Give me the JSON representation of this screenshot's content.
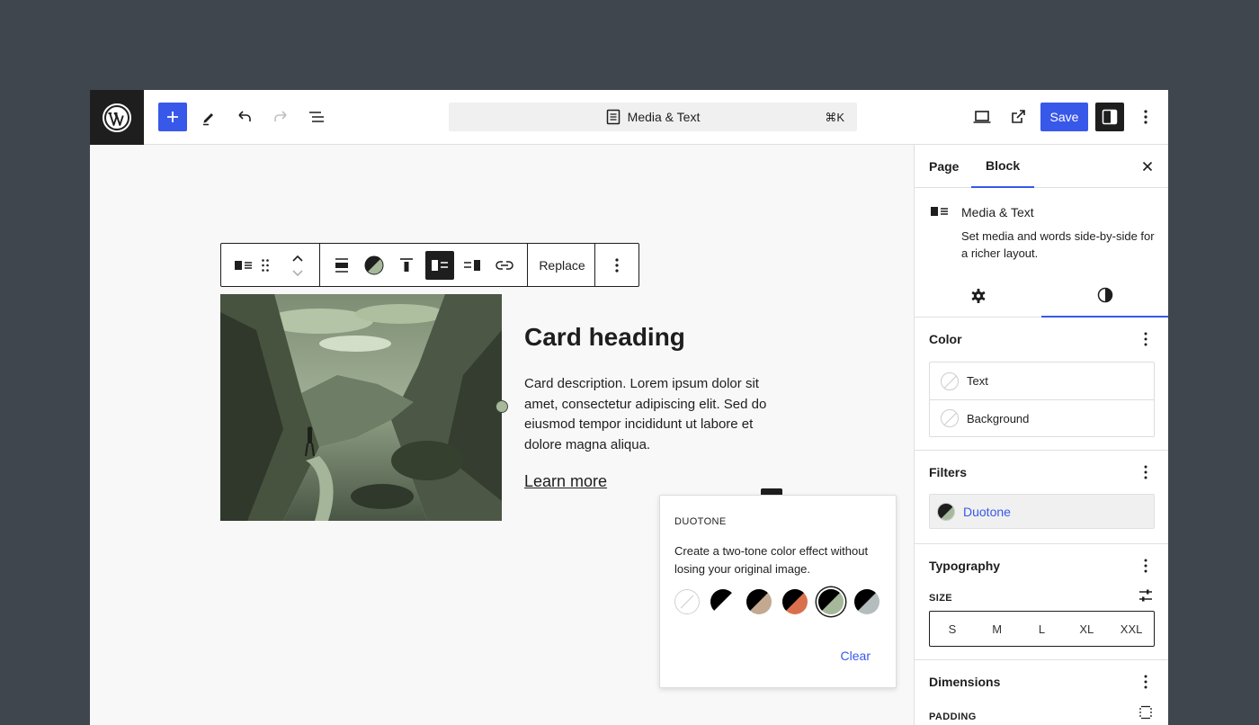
{
  "topbar": {
    "command_title": "Media & Text",
    "command_shortcut": "⌘K",
    "save_label": "Save"
  },
  "block_toolbar": {
    "replace_label": "Replace"
  },
  "content": {
    "heading": "Card heading",
    "description": "Card description. Lorem ipsum dolor sit amet, consectetur adipiscing elit. Sed do eiusmod tempor incididunt ut labore et dolore magna aliqua.",
    "link": "Learn more"
  },
  "duotone_popover": {
    "title": "DUOTONE",
    "description": "Create a two-tone color effect without losing your original image.",
    "clear_label": "Clear",
    "swatches": [
      {
        "name": "none",
        "colors": [
          "#ffffff",
          "#ffffff"
        ]
      },
      {
        "name": "dark-white",
        "colors": [
          "#000000",
          "#ffffff"
        ]
      },
      {
        "name": "dark-tan",
        "colors": [
          "#000000",
          "#c2a990"
        ]
      },
      {
        "name": "dark-orange",
        "colors": [
          "#000000",
          "#d9704d"
        ]
      },
      {
        "name": "dark-sage",
        "colors": [
          "#000000",
          "#a6b89a"
        ],
        "selected": true
      },
      {
        "name": "dark-grey",
        "colors": [
          "#000000",
          "#b4bcbd"
        ]
      }
    ]
  },
  "sidebar": {
    "tabs": [
      {
        "label": "Page"
      },
      {
        "label": "Block",
        "active": true
      }
    ],
    "block": {
      "title": "Media & Text",
      "description": "Set media and words side-by-side for a richer layout."
    },
    "color": {
      "title": "Color",
      "items": [
        "Text",
        "Background"
      ]
    },
    "filters": {
      "title": "Filters",
      "duotone_label": "Duotone"
    },
    "typography": {
      "title": "Typography",
      "size_label": "SIZE",
      "sizes": [
        "S",
        "M",
        "L",
        "XL",
        "XXL"
      ]
    },
    "dimensions": {
      "title": "Dimensions",
      "padding_label": "PADDING"
    }
  },
  "colors": {
    "accent": "#3858e9",
    "dark": "#1e1e1e",
    "backdrop": "#40464d"
  }
}
